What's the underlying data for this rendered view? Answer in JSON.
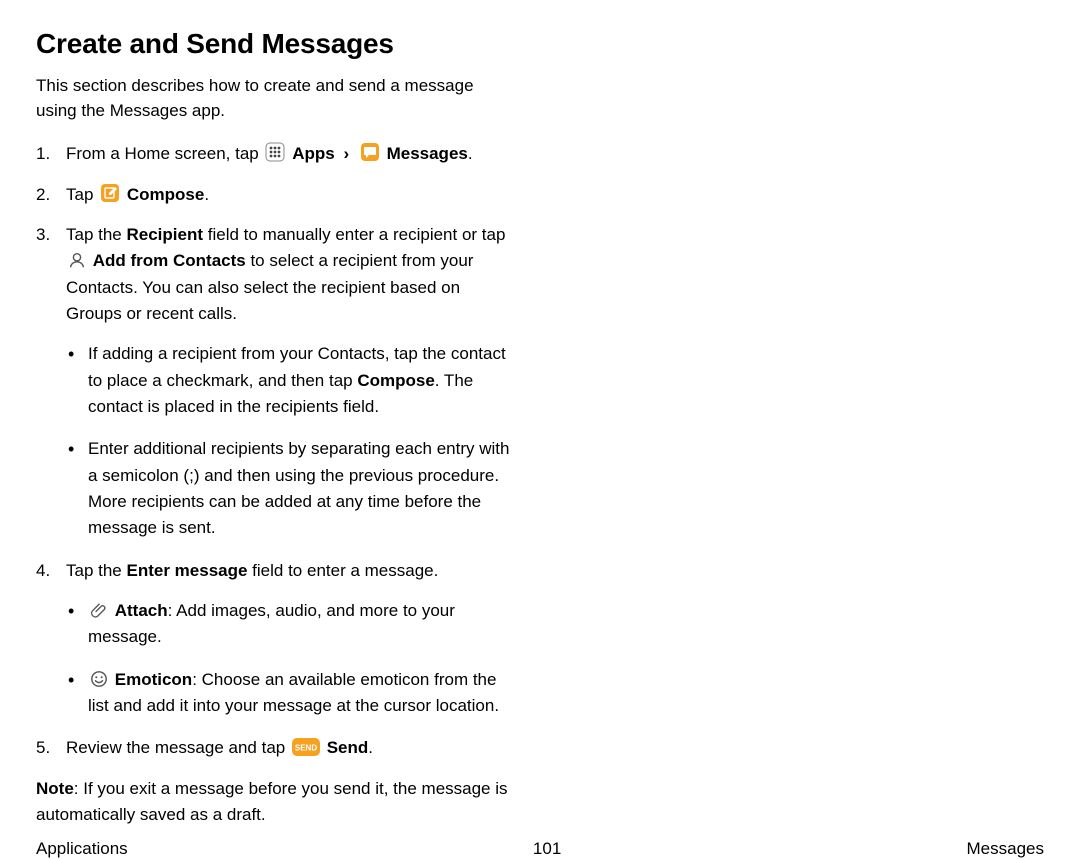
{
  "title": "Create and Send Messages",
  "intro": "This section describes how to create and send a message using the Messages app.",
  "steps": {
    "s1": {
      "pre": "From a Home screen, tap ",
      "apps": "Apps",
      "chev": "›",
      "messages": "Messages",
      "post": "."
    },
    "s2": {
      "pre": "Tap ",
      "compose": "Compose",
      "post": "."
    },
    "s3": {
      "a": "Tap the ",
      "recipient": "Recipient",
      "b": " field to manually enter a recipient or tap ",
      "addcontacts": "Add from Contacts",
      "c": " to select a recipient from your Contacts. You can also select the recipient based on Groups or recent calls.",
      "sub1a": "If adding a recipient from your Contacts, tap the contact to place a checkmark, and then tap ",
      "sub1b": "Compose",
      "sub1c": ". The contact is placed in the recipients field.",
      "sub2": "Enter additional recipients by separating each entry with a semicolon (;) and then using the previous procedure. More recipients can be added at any time before the message is sent."
    },
    "s4": {
      "a": "Tap the ",
      "enter": "Enter message",
      "b": " field to enter a message.",
      "attach_label": "Attach",
      "attach_desc": ": Add images, audio, and more to your message.",
      "emoticon_label": "Emoticon",
      "emoticon_desc": ": Choose an available emoticon from the list and add it into your message at the cursor location."
    },
    "s5": {
      "a": "Review the message and tap ",
      "send": "Send",
      "b": "."
    }
  },
  "note_label": "Note",
  "note_text": ": If you exit a message before you send it, the message is automatically saved as a draft.",
  "footer": {
    "left": "Applications",
    "page": "101",
    "right": "Messages"
  },
  "colors": {
    "orange": "#f6a11f",
    "grey_icon": "#555555"
  }
}
